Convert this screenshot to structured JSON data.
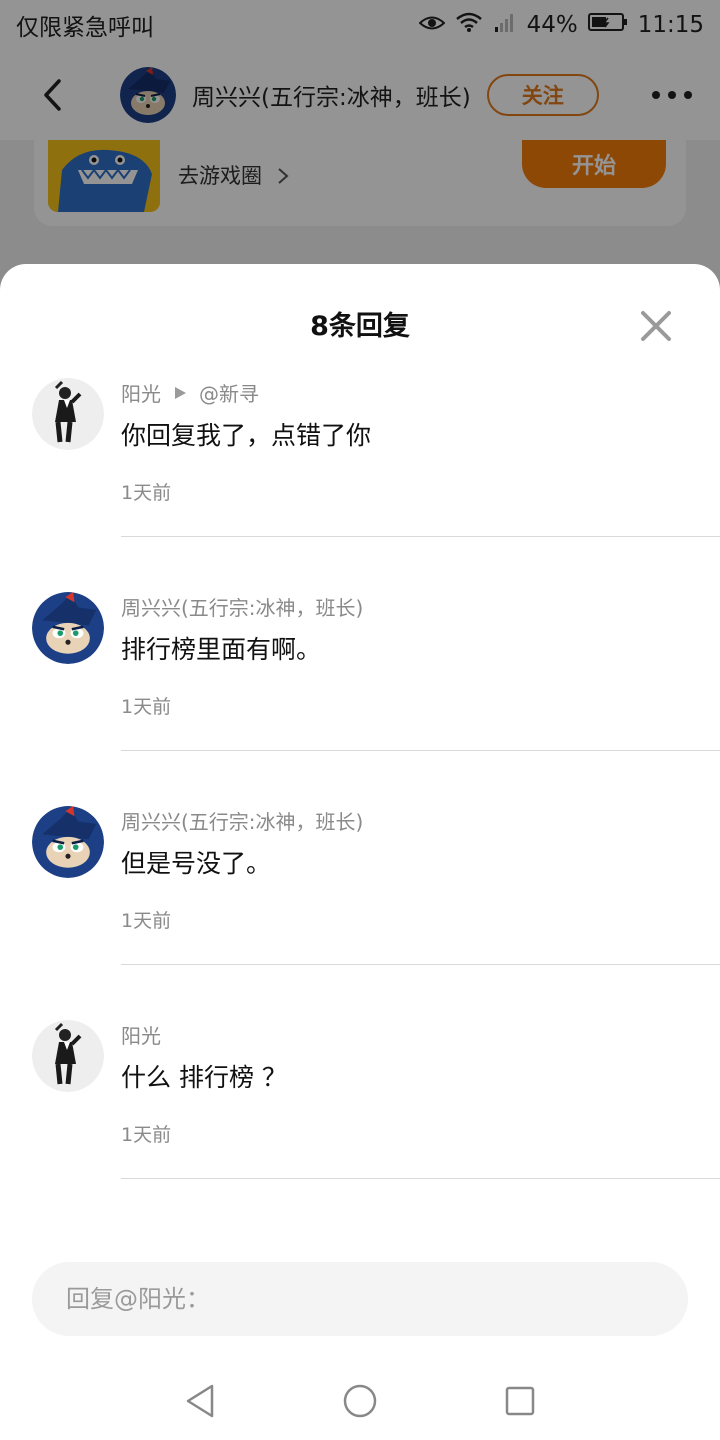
{
  "status_bar": {
    "carrier_text": "仅限紧急呼叫",
    "battery": "44%",
    "time": "11:15"
  },
  "header": {
    "username": "周兴兴(五行宗:冰神，班长)",
    "follow_label": "关注"
  },
  "game_card": {
    "link_label": "去游戏圈",
    "start_label": "开始"
  },
  "sheet": {
    "title": "8条回复",
    "comments": [
      {
        "author": "阳光",
        "reply_to": "@新寻",
        "text": "你回复我了，点错了你",
        "time": "1天前",
        "avatar_icon": "suited-man-avatar"
      },
      {
        "author": "周兴兴(五行宗:冰神，班长)",
        "text": "排行榜里面有啊。",
        "time": "1天前",
        "avatar_icon": "blue-hedgehog-avatar"
      },
      {
        "author": "周兴兴(五行宗:冰神，班长)",
        "text": "但是号没了。",
        "time": "1天前",
        "avatar_icon": "blue-hedgehog-avatar"
      },
      {
        "author": "阳光",
        "text": "什么 排行榜 ？",
        "time": "1天前",
        "avatar_icon": "suited-man-avatar"
      }
    ]
  },
  "reply": {
    "placeholder": "回复@阳光："
  },
  "colors": {
    "accent": "#e07a1e",
    "start_button": "#f57c0a",
    "text_primary": "#111111",
    "text_secondary": "#8a8a8a"
  }
}
